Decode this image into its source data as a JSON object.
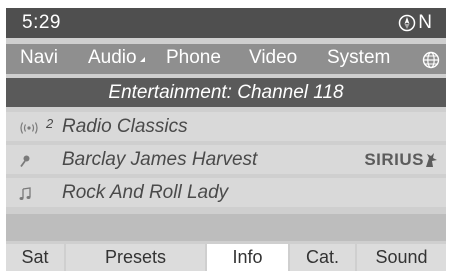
{
  "status": {
    "time": "5:29",
    "compass": "N",
    "compass_icon": "compass-icon"
  },
  "main_menu": {
    "items": [
      {
        "label": "Navi"
      },
      {
        "label": "Audio",
        "selected": true
      },
      {
        "label": "Phone"
      },
      {
        "label": "Video"
      },
      {
        "label": "System"
      }
    ],
    "globe_icon": "globe-icon"
  },
  "heading": "Entertainment: Channel 118",
  "info_rows": [
    {
      "icon": "signal-icon",
      "preset_number": "2",
      "text": "Radio Classics"
    },
    {
      "icon": "microphone-icon",
      "text": "Barclay James Harvest"
    },
    {
      "icon": "music-note-icon",
      "text": "Rock And Roll Lady"
    }
  ],
  "sirius_logo": "SIRIUS",
  "soft_buttons": [
    {
      "label": "Sat"
    },
    {
      "label": "Presets"
    },
    {
      "label": "Info",
      "active": true
    },
    {
      "label": "Cat."
    },
    {
      "label": "Sound"
    }
  ],
  "colors": {
    "status_bar": "#4f4f4f",
    "menu_bar": "#8f8f8f",
    "heading_bar": "#5a5a5a",
    "info_row": "#d9d9d9",
    "soft_button": "#dcdcdc",
    "soft_button_active": "#ffffff"
  }
}
